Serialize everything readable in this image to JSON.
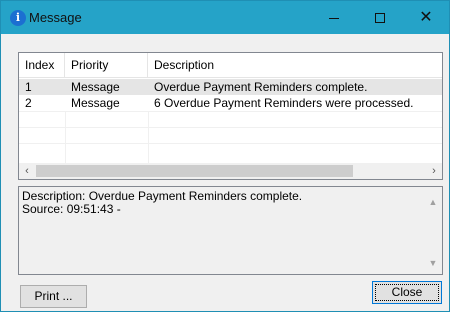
{
  "window": {
    "title": "Message",
    "title_icon": "info-icon",
    "titlebar_color": "#25a3c8",
    "controls": {
      "minimize": "minimize-icon",
      "maximize": "maximize-icon",
      "close": "✕"
    }
  },
  "list": {
    "columns": [
      "Index",
      "Priority",
      "Description"
    ],
    "rows": [
      {
        "index": "1",
        "priority": "Message",
        "description": "Overdue Payment Reminders complete."
      },
      {
        "index": "2",
        "priority": "Message",
        "description": "6 Overdue Payment Reminders were processed."
      }
    ],
    "scroll_left": "‹",
    "scroll_right": "›"
  },
  "details": {
    "line1": "Description: Overdue Payment Reminders complete.",
    "line2": "Source:  09:51:43 -"
  },
  "buttons": {
    "print": "Print ...",
    "close": "Close"
  }
}
